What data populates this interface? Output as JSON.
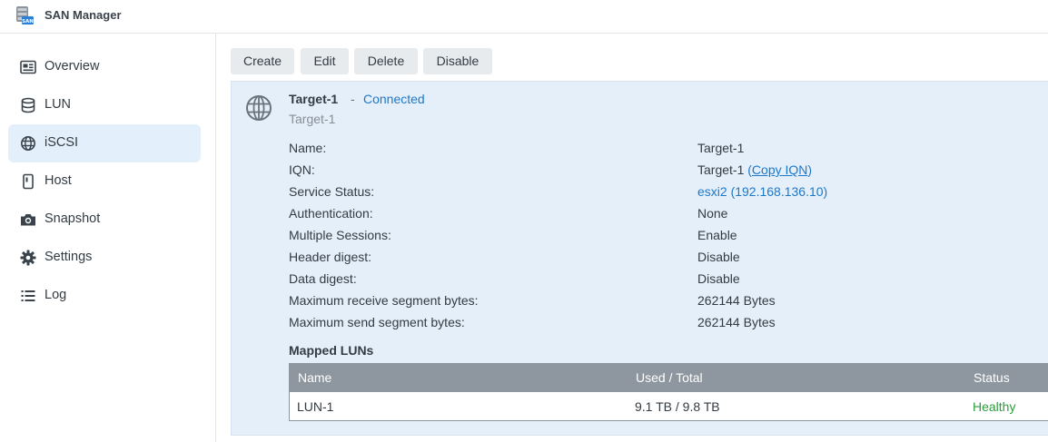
{
  "app": {
    "title": "SAN Manager",
    "icon": "san-manager-icon"
  },
  "sidebar": {
    "items": [
      {
        "label": "Overview",
        "icon": "overview-icon",
        "active": false
      },
      {
        "label": "LUN",
        "icon": "database-icon",
        "active": false
      },
      {
        "label": "iSCSI",
        "icon": "globe-icon",
        "active": true
      },
      {
        "label": "Host",
        "icon": "host-icon",
        "active": false
      },
      {
        "label": "Snapshot",
        "icon": "camera-icon",
        "active": false
      },
      {
        "label": "Settings",
        "icon": "gear-icon",
        "active": false
      },
      {
        "label": "Log",
        "icon": "list-icon",
        "active": false
      }
    ]
  },
  "toolbar": {
    "create_label": "Create",
    "edit_label": "Edit",
    "delete_label": "Delete",
    "disable_label": "Disable"
  },
  "target": {
    "name": "Target-1",
    "separator": "-",
    "status": "Connected",
    "subtitle": "Target-1",
    "properties": [
      {
        "label": "Name:",
        "value": "Target-1"
      },
      {
        "label": "IQN:",
        "value": "Target-1",
        "link_open": "(",
        "link": "Copy IQN",
        "link_close": ")"
      },
      {
        "label": "Service Status:",
        "value": "esxi2 (192.168.136.10)"
      },
      {
        "label": "Authentication:",
        "value": "None"
      },
      {
        "label": "Multiple Sessions:",
        "value": "Enable"
      },
      {
        "label": "Header digest:",
        "value": "Disable"
      },
      {
        "label": "Data digest:",
        "value": "Disable"
      },
      {
        "label": "Maximum receive segment bytes:",
        "value": "262144 Bytes"
      },
      {
        "label": "Maximum send segment bytes:",
        "value": "262144 Bytes"
      }
    ]
  },
  "mapped_luns": {
    "title": "Mapped LUNs",
    "columns": [
      "Name",
      "Used / Total",
      "Status"
    ],
    "rows": [
      {
        "name": "LUN-1",
        "used_total": "9.1 TB / 9.8 TB",
        "status": "Healthy"
      }
    ]
  },
  "colors": {
    "accent": "#1e78c8",
    "selected_bg": "#e3effa",
    "healthy": "#2a9d3a",
    "table_header": "#8e979f"
  }
}
